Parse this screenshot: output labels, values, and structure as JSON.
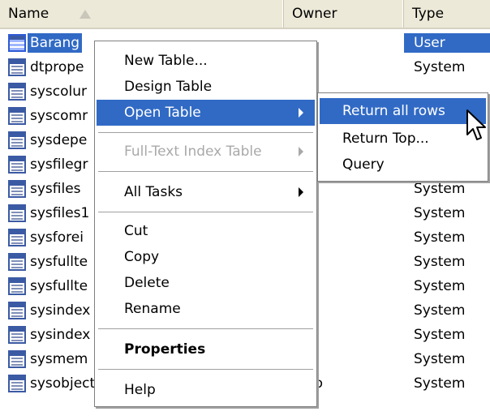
{
  "columns": {
    "name": "Name",
    "owner": "Owner",
    "type": "Type"
  },
  "rows": [
    {
      "name": "Barang",
      "owner": "",
      "type": "User",
      "icon": "user-table-icon",
      "selected": true
    },
    {
      "name": "dtprope",
      "owner": "",
      "type": "System",
      "icon": "system-table-icon"
    },
    {
      "name": "syscolur",
      "owner": "",
      "type": "",
      "icon": "system-table-icon"
    },
    {
      "name": "syscomr",
      "owner": "",
      "type": "",
      "icon": "system-table-icon"
    },
    {
      "name": "sysdepe",
      "owner": "",
      "type": "",
      "icon": "system-table-icon"
    },
    {
      "name": "sysfilegr",
      "owner": "",
      "type": "",
      "icon": "system-table-icon"
    },
    {
      "name": "sysfiles",
      "owner": "",
      "type": "System",
      "icon": "system-table-icon"
    },
    {
      "name": "sysfiles1",
      "owner": "",
      "type": "System",
      "icon": "system-table-icon"
    },
    {
      "name": "sysforei",
      "owner": "",
      "type": "System",
      "icon": "system-table-icon"
    },
    {
      "name": "sysfullte",
      "owner": "",
      "type": "System",
      "icon": "system-table-icon"
    },
    {
      "name": "sysfullte",
      "owner": "",
      "type": "System",
      "icon": "system-table-icon"
    },
    {
      "name": "sysindex",
      "owner": "",
      "type": "System",
      "icon": "system-table-icon"
    },
    {
      "name": "sysindex",
      "owner": "",
      "type": "System",
      "icon": "system-table-icon"
    },
    {
      "name": "sysmem",
      "owner": "",
      "type": "System",
      "icon": "system-table-icon"
    },
    {
      "name": "sysobjects",
      "owner": "dbo",
      "type": "System",
      "icon": "system-table-icon"
    }
  ],
  "context_menu": {
    "new_table": "New Table...",
    "design_table": "Design Table",
    "open_table": "Open Table",
    "full_text_index_table": "Full-Text Index Table",
    "all_tasks": "All Tasks",
    "cut": "Cut",
    "copy": "Copy",
    "delete": "Delete",
    "rename": "Rename",
    "properties": "Properties",
    "help": "Help"
  },
  "submenu": {
    "return_all_rows": "Return all rows",
    "return_top": "Return Top...",
    "query": "Query"
  },
  "colors": {
    "selection": "#316ac5",
    "menu_border": "#808080",
    "disabled_text": "#a9a9a9",
    "header_bg": "#ece9d8"
  }
}
